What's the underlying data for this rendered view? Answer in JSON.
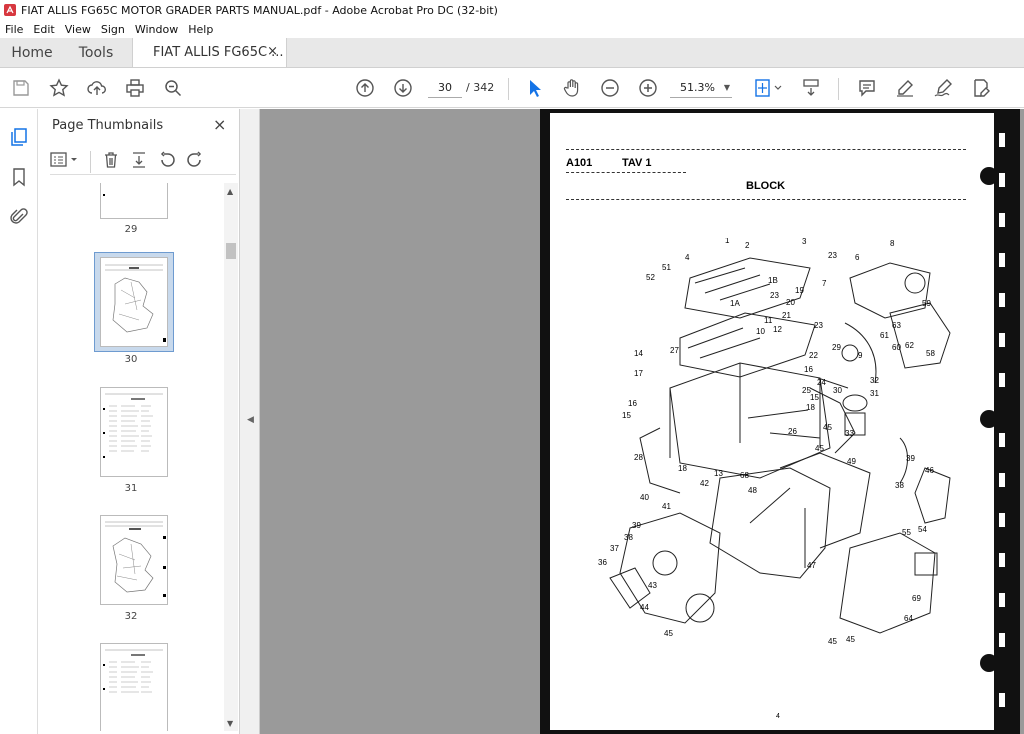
{
  "window": {
    "title": "FIAT ALLIS FG65C MOTOR GRADER PARTS MANUAL.pdf - Adobe Acrobat Pro DC (32-bit)"
  },
  "menu": [
    "File",
    "Edit",
    "View",
    "Sign",
    "Window",
    "Help"
  ],
  "tabs": {
    "home": "Home",
    "tools": "Tools",
    "doc": "FIAT ALLIS FG65C ...",
    "close": "×"
  },
  "toolbar": {
    "page_current": "30",
    "page_total": "/ 342",
    "zoom": "51.3%"
  },
  "panel": {
    "title": "Page Thumbnails",
    "close": "×"
  },
  "thumbnails": [
    {
      "label": "29"
    },
    {
      "label": "30",
      "selected": true
    },
    {
      "label": "31"
    },
    {
      "label": "32"
    }
  ],
  "pdf_page": {
    "code": "A101",
    "tav": "TAV 1",
    "title": "BLOCK",
    "page_number": "4",
    "callouts": [
      "1",
      "2",
      "3",
      "4",
      "51",
      "52",
      "23",
      "6",
      "8",
      "7",
      "1B",
      "1A",
      "23",
      "19",
      "20",
      "21",
      "23",
      "59",
      "63",
      "61",
      "60",
      "62",
      "58",
      "11",
      "10",
      "12",
      "22",
      "9",
      "29",
      "14",
      "27",
      "16",
      "17",
      "24",
      "25",
      "32",
      "30",
      "15",
      "31",
      "18",
      "16",
      "15",
      "26",
      "45",
      "33",
      "28",
      "18",
      "13",
      "68",
      "49",
      "39",
      "46",
      "38",
      "42",
      "48",
      "45",
      "40",
      "41",
      "39",
      "38",
      "37",
      "36",
      "43",
      "44",
      "45",
      "47",
      "55",
      "54",
      "69",
      "64",
      "45",
      "45"
    ]
  },
  "colors": {
    "accent": "#1473e6",
    "acrobat_red": "#d7373f",
    "viewer_bg": "#9a9a9a"
  }
}
